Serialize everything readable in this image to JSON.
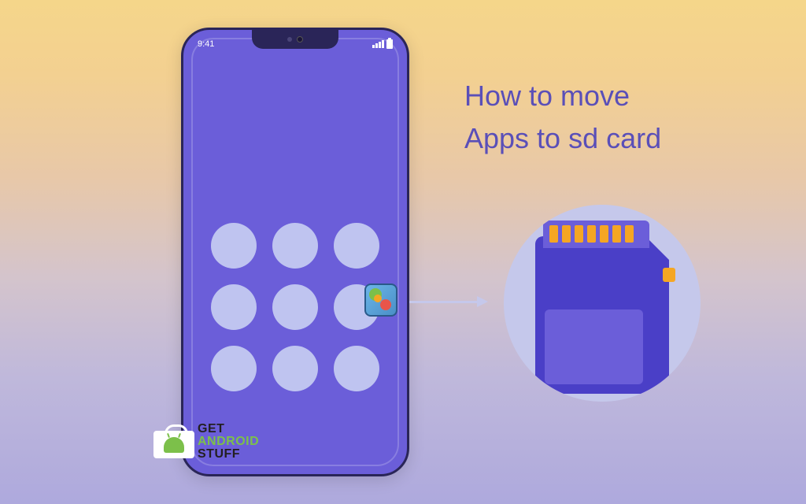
{
  "title_line1": "How to move",
  "title_line2": "Apps to sd card",
  "status": {
    "time": "9:41"
  },
  "watermark": {
    "line1": "GET",
    "line2": "ANDROID",
    "line3": "STUFF"
  },
  "colors": {
    "phone_bg": "#6b5ed9",
    "accent": "#5a4fb8",
    "sd_contact": "#f5a623"
  }
}
